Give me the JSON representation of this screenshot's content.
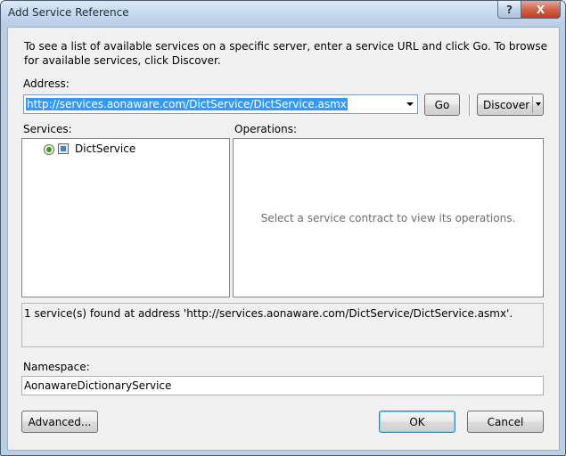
{
  "window": {
    "title": "Add Service Reference",
    "help_label": "?",
    "close_label": "X"
  },
  "instructions": "To see a list of available services on a specific server, enter a service URL and click Go. To browse for available services, click Discover.",
  "address": {
    "label": "Address:",
    "value": "http://services.aonaware.com/DictService/DictService.asmx"
  },
  "buttons": {
    "go": "Go",
    "discover": "Discover",
    "advanced": "Advanced...",
    "ok": "OK",
    "cancel": "Cancel"
  },
  "services": {
    "label": "Services:",
    "items": [
      {
        "name": "DictService"
      }
    ]
  },
  "operations": {
    "label": "Operations:",
    "empty_message": "Select a service contract to view its operations."
  },
  "status": "1 service(s) found at address 'http://services.aonaware.com/DictService/DictService.asmx'.",
  "namespace": {
    "label": "Namespace:",
    "value": "AonawareDictionaryService"
  }
}
